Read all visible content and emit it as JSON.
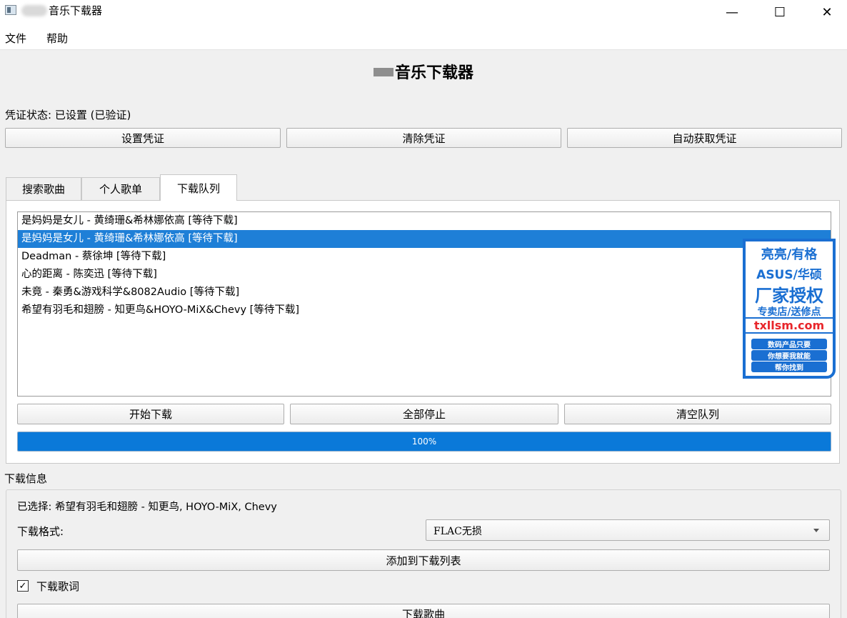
{
  "window": {
    "title": "音乐下载器",
    "controls": {
      "minimize": "—",
      "maximize": "☐",
      "close": "✕"
    }
  },
  "menu": {
    "items": [
      "文件",
      "帮助"
    ]
  },
  "heading": "音乐下载器",
  "credentials": {
    "status_label": "凭证状态: 已设置 (已验证)",
    "buttons": {
      "set": "设置凭证",
      "clear": "清除凭证",
      "auto": "自动获取凭证"
    }
  },
  "tabs": [
    {
      "label": "搜索歌曲",
      "active": false
    },
    {
      "label": "个人歌单",
      "active": false
    },
    {
      "label": "下载队列",
      "active": true
    }
  ],
  "queue": {
    "items": [
      "是妈妈是女儿 - 黄绮珊&希林娜依高 [等待下载]",
      "是妈妈是女儿 - 黄绮珊&希林娜依高 [等待下载]",
      "Deadman - 蔡徐坤 [等待下载]",
      "心的距离 - 陈奕迅 [等待下载]",
      "未竟 - 秦勇&游戏科学&8082Audio [等待下载]",
      "希望有羽毛和翅膀 - 知更鸟&HOYO-MiX&Chevy [等待下载]"
    ],
    "selected_index": 1,
    "buttons": {
      "start": "开始下载",
      "stop_all": "全部停止",
      "clear": "清空队列"
    },
    "progress": {
      "value": 100,
      "text": "100%"
    }
  },
  "download_info": {
    "section_label": "下载信息",
    "selected_text": "已选择: 希望有羽毛和翅膀 - 知更鸟, HOYO-MiX, Chevy",
    "format_label": "下载格式:",
    "format_value": "FLAC无损",
    "add_button": "添加到下载列表",
    "lyrics_checkbox": {
      "label": "下载歌词",
      "checked": true,
      "mark": "✓"
    },
    "download_button": "下载歌曲"
  },
  "watermark": {
    "lines": [
      "亮亮/有格",
      "ASUS/华硕",
      "厂家授权",
      "专卖店/送修点",
      "txllsm.com"
    ],
    "sub_lines": [
      "数码产品只要",
      "你想要我就能",
      "帮你找到"
    ]
  },
  "colors": {
    "accent": "#1e7fd7",
    "progress": "#0a79d9",
    "stamp_blue": "#1a6fd2",
    "stamp_red": "#e8262b"
  }
}
